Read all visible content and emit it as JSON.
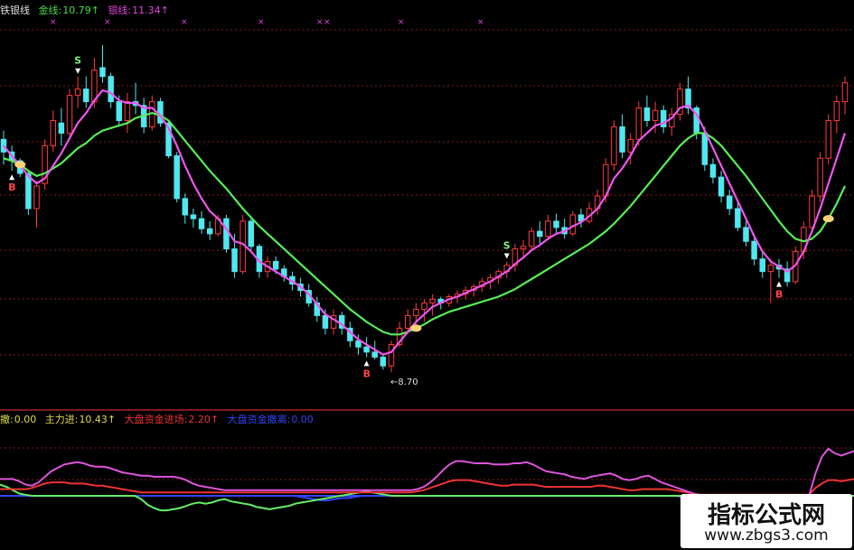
{
  "chart_data": {
    "type": "candlestick",
    "main_panel": {
      "legend": [
        {
          "label": "铁银线",
          "value": "",
          "color": "#e0e0e0"
        },
        {
          "label": "金线:",
          "value": "10.79↑",
          "color": "#44dd44"
        },
        {
          "label": "银线:",
          "value": "11.34↑",
          "color": "#dd44dd"
        }
      ],
      "annotations": {
        "low_price_label": "←8.70",
        "sell_marker": "S",
        "buy_marker": "B"
      },
      "candles": [
        [
          10.55,
          10.62,
          10.35,
          10.45
        ],
        [
          10.45,
          10.5,
          10.3,
          10.38
        ],
        [
          10.38,
          10.4,
          10.25,
          10.28
        ],
        [
          10.28,
          10.3,
          9.95,
          10.0
        ],
        [
          10.0,
          10.22,
          9.85,
          10.18
        ],
        [
          10.2,
          10.55,
          10.15,
          10.5
        ],
        [
          10.5,
          10.78,
          10.45,
          10.7
        ],
        [
          10.68,
          10.8,
          10.5,
          10.6
        ],
        [
          10.6,
          10.95,
          10.58,
          10.9
        ],
        [
          10.9,
          11.05,
          10.8,
          10.95
        ],
        [
          10.95,
          11.05,
          10.8,
          10.85
        ],
        [
          10.85,
          11.2,
          10.8,
          11.1
        ],
        [
          11.12,
          11.3,
          11.0,
          11.05
        ],
        [
          11.05,
          11.08,
          10.8,
          10.85
        ],
        [
          10.85,
          10.9,
          10.65,
          10.7
        ],
        [
          10.7,
          10.92,
          10.6,
          10.85
        ],
        [
          10.85,
          11.0,
          10.75,
          10.82
        ],
        [
          10.82,
          10.88,
          10.6,
          10.65
        ],
        [
          10.65,
          10.9,
          10.62,
          10.85
        ],
        [
          10.85,
          10.88,
          10.65,
          10.68
        ],
        [
          10.68,
          10.7,
          10.4,
          10.42
        ],
        [
          10.42,
          10.45,
          10.05,
          10.08
        ],
        [
          10.08,
          10.12,
          9.88,
          9.95
        ],
        [
          9.95,
          10.0,
          9.85,
          9.92
        ],
        [
          9.92,
          9.98,
          9.8,
          9.84
        ],
        [
          9.84,
          9.9,
          9.75,
          9.8
        ],
        [
          9.8,
          9.95,
          9.78,
          9.92
        ],
        [
          9.92,
          9.95,
          9.65,
          9.68
        ],
        [
          9.68,
          9.8,
          9.45,
          9.5
        ],
        [
          9.5,
          9.95,
          9.48,
          9.9
        ],
        [
          9.9,
          9.92,
          9.65,
          9.7
        ],
        [
          9.7,
          9.72,
          9.45,
          9.5
        ],
        [
          9.5,
          9.62,
          9.45,
          9.58
        ],
        [
          9.58,
          9.62,
          9.48,
          9.52
        ],
        [
          9.52,
          9.55,
          9.42,
          9.46
        ],
        [
          9.46,
          9.5,
          9.35,
          9.4
        ],
        [
          9.4,
          9.45,
          9.3,
          9.35
        ],
        [
          9.35,
          9.4,
          9.22,
          9.25
        ],
        [
          9.25,
          9.3,
          9.1,
          9.15
        ],
        [
          9.15,
          9.2,
          9.0,
          9.05
        ],
        [
          9.05,
          9.2,
          9.0,
          9.15
        ],
        [
          9.15,
          9.18,
          9.0,
          9.05
        ],
        [
          9.05,
          9.1,
          8.9,
          8.95
        ],
        [
          8.95,
          9.0,
          8.84,
          8.9
        ],
        [
          8.9,
          8.98,
          8.82,
          8.86
        ],
        [
          8.86,
          8.95,
          8.8,
          8.82
        ],
        [
          8.82,
          8.85,
          8.72,
          8.75
        ],
        [
          8.75,
          8.95,
          8.7,
          8.92
        ],
        [
          8.92,
          9.1,
          8.9,
          9.05
        ],
        [
          9.05,
          9.2,
          9.0,
          9.15
        ],
        [
          9.15,
          9.25,
          9.05,
          9.2
        ],
        [
          9.2,
          9.28,
          9.1,
          9.25
        ],
        [
          9.25,
          9.32,
          9.15,
          9.28
        ],
        [
          9.28,
          9.3,
          9.2,
          9.25
        ],
        [
          9.25,
          9.32,
          9.22,
          9.3
        ],
        [
          9.3,
          9.35,
          9.25,
          9.32
        ],
        [
          9.32,
          9.38,
          9.28,
          9.35
        ],
        [
          9.35,
          9.4,
          9.3,
          9.38
        ],
        [
          9.38,
          9.45,
          9.34,
          9.42
        ],
        [
          9.42,
          9.48,
          9.36,
          9.45
        ],
        [
          9.45,
          9.52,
          9.4,
          9.5
        ],
        [
          9.5,
          9.58,
          9.45,
          9.55
        ],
        [
          9.55,
          9.72,
          9.5,
          9.68
        ],
        [
          9.68,
          9.75,
          9.6,
          9.7
        ],
        [
          9.7,
          9.85,
          9.66,
          9.82
        ],
        [
          9.82,
          9.9,
          9.72,
          9.78
        ],
        [
          9.78,
          9.95,
          9.75,
          9.9
        ],
        [
          9.9,
          9.96,
          9.8,
          9.85
        ],
        [
          9.85,
          9.92,
          9.76,
          9.8
        ],
        [
          9.8,
          9.98,
          9.78,
          9.95
        ],
        [
          9.95,
          10.0,
          9.85,
          9.9
        ],
        [
          9.9,
          10.05,
          9.88,
          10.0
        ],
        [
          10.0,
          10.15,
          9.95,
          10.1
        ],
        [
          10.1,
          10.4,
          10.05,
          10.35
        ],
        [
          10.35,
          10.7,
          10.3,
          10.65
        ],
        [
          10.65,
          10.75,
          10.4,
          10.45
        ],
        [
          10.45,
          10.6,
          10.35,
          10.55
        ],
        [
          10.55,
          10.85,
          10.5,
          10.8
        ],
        [
          10.8,
          10.9,
          10.65,
          10.7
        ],
        [
          10.7,
          10.85,
          10.6,
          10.78
        ],
        [
          10.78,
          10.82,
          10.6,
          10.65
        ],
        [
          10.65,
          10.8,
          10.58,
          10.75
        ],
        [
          10.75,
          11.0,
          10.7,
          10.95
        ],
        [
          10.95,
          11.05,
          10.75,
          10.8
        ],
        [
          10.8,
          10.82,
          10.55,
          10.6
        ],
        [
          10.6,
          10.65,
          10.3,
          10.35
        ],
        [
          10.35,
          10.4,
          10.2,
          10.25
        ],
        [
          10.25,
          10.3,
          10.05,
          10.1
        ],
        [
          10.1,
          10.15,
          9.95,
          10.0
        ],
        [
          10.0,
          10.05,
          9.82,
          9.85
        ],
        [
          9.85,
          9.9,
          9.7,
          9.74
        ],
        [
          9.74,
          9.8,
          9.55,
          9.6
        ],
        [
          9.6,
          9.65,
          9.45,
          9.5
        ],
        [
          9.5,
          9.6,
          9.25,
          9.55
        ],
        [
          9.55,
          9.6,
          9.45,
          9.52
        ],
        [
          9.52,
          9.58,
          9.38,
          9.42
        ],
        [
          9.42,
          9.7,
          9.4,
          9.66
        ],
        [
          9.66,
          9.9,
          9.6,
          9.85
        ],
        [
          9.85,
          10.15,
          9.8,
          10.1
        ],
        [
          10.1,
          10.45,
          10.05,
          10.4
        ],
        [
          10.4,
          10.75,
          10.35,
          10.7
        ],
        [
          10.7,
          10.9,
          10.6,
          10.85
        ],
        [
          10.85,
          11.05,
          10.75,
          11.0
        ]
      ],
      "gold_line": [
        10.4,
        10.38,
        10.35,
        10.3,
        10.26,
        10.28,
        10.32,
        10.36,
        10.42,
        10.48,
        10.52,
        10.58,
        10.62,
        10.64,
        10.66,
        10.68,
        10.72,
        10.74,
        10.76,
        10.74,
        10.7,
        10.62,
        10.54,
        10.46,
        10.38,
        10.3,
        10.23,
        10.16,
        10.08,
        10.0,
        9.93,
        9.86,
        9.8,
        9.74,
        9.68,
        9.62,
        9.56,
        9.5,
        9.44,
        9.38,
        9.32,
        9.26,
        9.2,
        9.15,
        9.1,
        9.06,
        9.02,
        9.0,
        9.0,
        9.02,
        9.05,
        9.08,
        9.12,
        9.15,
        9.18,
        9.2,
        9.22,
        9.24,
        9.26,
        9.28,
        9.3,
        9.33,
        9.36,
        9.4,
        9.44,
        9.48,
        9.52,
        9.56,
        9.6,
        9.64,
        9.68,
        9.72,
        9.77,
        9.82,
        9.88,
        9.95,
        10.02,
        10.1,
        10.18,
        10.26,
        10.34,
        10.42,
        10.5,
        10.56,
        10.6,
        10.6,
        10.56,
        10.5,
        10.42,
        10.34,
        10.26,
        10.17,
        10.08,
        9.99,
        9.9,
        9.82,
        9.76,
        9.74,
        9.76,
        9.82,
        9.92,
        10.04,
        10.18
      ],
      "silver_line": [
        10.5,
        10.42,
        10.34,
        10.26,
        10.2,
        10.24,
        10.34,
        10.44,
        10.56,
        10.68,
        10.76,
        10.86,
        10.94,
        10.92,
        10.86,
        10.84,
        10.84,
        10.8,
        10.8,
        10.74,
        10.64,
        10.5,
        10.34,
        10.2,
        10.08,
        9.98,
        9.92,
        9.84,
        9.74,
        9.72,
        9.66,
        9.58,
        9.54,
        9.5,
        9.46,
        9.42,
        9.38,
        9.32,
        9.24,
        9.16,
        9.12,
        9.08,
        9.02,
        8.96,
        8.92,
        8.88,
        8.84,
        8.86,
        8.94,
        9.02,
        9.1,
        9.16,
        9.22,
        9.25,
        9.28,
        9.3,
        9.33,
        9.36,
        9.39,
        9.42,
        9.46,
        9.5,
        9.56,
        9.61,
        9.67,
        9.71,
        9.76,
        9.8,
        9.82,
        9.86,
        9.89,
        9.94,
        10.0,
        10.1,
        10.24,
        10.32,
        10.42,
        10.54,
        10.6,
        10.66,
        10.68,
        10.72,
        10.8,
        10.82,
        10.75,
        10.62,
        10.48,
        10.34,
        10.2,
        10.06,
        9.92,
        9.78,
        9.66,
        9.58,
        9.54,
        9.5,
        9.55,
        9.66,
        9.82,
        10.0,
        10.2,
        10.4,
        10.6
      ],
      "sell_signals": [
        [
          9,
          "S"
        ],
        [
          61,
          "S"
        ]
      ],
      "buy_signals": [
        [
          1,
          "B"
        ],
        [
          44,
          "B"
        ],
        [
          94,
          "B"
        ]
      ],
      "highlights": [
        2,
        50,
        100
      ]
    },
    "sub_panel": {
      "legend": [
        {
          "label": "撤:",
          "value": "0.00",
          "color": "#dddd44"
        },
        {
          "label": "主力进:",
          "value": "10.43↑",
          "color": "#dddd44"
        },
        {
          "label": "大盘资金进场:",
          "value": "2.20↑",
          "color": "#ee3333"
        },
        {
          "label": "大盘资金撤离:",
          "value": "0.00",
          "color": "#3344ee"
        }
      ],
      "magenta": [
        30,
        30,
        30,
        26,
        20,
        18,
        24,
        34,
        44,
        50,
        56,
        58,
        60,
        58,
        54,
        52,
        52,
        50,
        46,
        42,
        40,
        38,
        36,
        36,
        34,
        34,
        34,
        34,
        32,
        28,
        22,
        18,
        16,
        14,
        12,
        10,
        10,
        10,
        10,
        10,
        10,
        10,
        10,
        10,
        10,
        10,
        10,
        10,
        10,
        10,
        10,
        10,
        10,
        10,
        10,
        10,
        10,
        10,
        10,
        10,
        10,
        10,
        10,
        10,
        10,
        12,
        16,
        24,
        34,
        46,
        56,
        62,
        62,
        60,
        58,
        58,
        58,
        56,
        56,
        56,
        58,
        58,
        60,
        56,
        50,
        44,
        42,
        40,
        38,
        34,
        32,
        30,
        34,
        36,
        38,
        40,
        36,
        30,
        28,
        30,
        34,
        36,
        30,
        24,
        20,
        16,
        12,
        8,
        4,
        0,
        0,
        0,
        0,
        0,
        0,
        0,
        0,
        0,
        0,
        0,
        0,
        0,
        0,
        0,
        0,
        0,
        0,
        40,
        70,
        84,
        76,
        72,
        76,
        80
      ],
      "red": [
        12,
        12,
        12,
        12,
        12,
        14,
        18,
        22,
        24,
        24,
        24,
        22,
        22,
        22,
        20,
        18,
        18,
        16,
        14,
        12,
        10,
        8,
        6,
        6,
        6,
        6,
        6,
        6,
        6,
        6,
        6,
        6,
        6,
        6,
        6,
        6,
        6,
        6,
        6,
        6,
        6,
        6,
        6,
        6,
        6,
        6,
        6,
        6,
        6,
        6,
        6,
        6,
        6,
        6,
        6,
        6,
        6,
        6,
        6,
        6,
        6,
        6,
        6,
        6,
        6,
        8,
        10,
        14,
        18,
        22,
        26,
        28,
        28,
        28,
        26,
        24,
        22,
        20,
        18,
        18,
        20,
        20,
        20,
        20,
        18,
        16,
        16,
        16,
        16,
        16,
        16,
        16,
        16,
        18,
        18,
        16,
        14,
        12,
        10,
        10,
        12,
        12,
        12,
        12,
        12,
        10,
        8,
        6,
        4,
        2,
        2,
        2,
        2,
        2,
        2,
        2,
        2,
        2,
        2,
        2,
        2,
        2,
        2,
        2,
        2,
        2,
        2,
        14,
        22,
        28,
        28,
        26,
        28,
        30
      ],
      "green": [
        20,
        16,
        10,
        4,
        2,
        0,
        0,
        0,
        0,
        0,
        0,
        0,
        0,
        0,
        0,
        0,
        0,
        0,
        0,
        0,
        0,
        0,
        -6,
        -16,
        -22,
        -26,
        -26,
        -24,
        -22,
        -18,
        -14,
        -12,
        -14,
        -12,
        -8,
        -6,
        -10,
        -12,
        -14,
        -16,
        -20,
        -22,
        -24,
        -22,
        -20,
        -18,
        -14,
        -12,
        -10,
        -8,
        -6,
        -4,
        -2,
        0,
        2,
        4,
        6,
        8,
        6,
        4,
        2,
        0,
        0,
        0,
        0,
        0,
        0,
        0,
        0,
        0,
        0,
        0,
        0,
        0,
        0,
        0,
        0,
        0,
        0,
        0,
        0,
        0,
        0,
        0,
        0,
        0,
        0,
        0,
        0,
        0,
        0,
        0,
        0,
        0,
        0,
        0,
        0,
        0,
        0,
        0,
        0,
        0,
        0,
        0,
        0,
        0,
        0,
        0,
        0,
        0,
        0,
        0,
        0,
        0,
        0,
        0,
        0,
        0,
        0,
        0,
        0,
        0,
        0,
        0,
        0,
        0,
        0,
        0,
        0,
        0,
        0,
        0,
        0,
        0
      ],
      "blue": [
        0,
        0,
        0,
        0,
        0,
        0,
        0,
        0,
        0,
        0,
        0,
        0,
        0,
        0,
        0,
        0,
        0,
        0,
        0,
        0,
        0,
        0,
        0,
        0,
        0,
        0,
        0,
        0,
        0,
        0,
        0,
        0,
        0,
        0,
        0,
        0,
        0,
        0,
        0,
        0,
        0,
        0,
        0,
        0,
        -2,
        -4,
        -6,
        -8,
        -8,
        -6,
        -4,
        -4,
        -2,
        0,
        0,
        0,
        0,
        0,
        0,
        0,
        0,
        0,
        0,
        0,
        0,
        0,
        0,
        0,
        0,
        0,
        0,
        0,
        0,
        0,
        0,
        0,
        0,
        0,
        0,
        0,
        0,
        0,
        0,
        0,
        0,
        0,
        0,
        0,
        0,
        0,
        0,
        0,
        0,
        0,
        0,
        0,
        0,
        0,
        0,
        0,
        -4,
        -6,
        -8,
        -10,
        -10,
        -8,
        -6,
        -4,
        -2,
        0,
        0,
        0,
        0,
        0,
        0,
        0,
        0,
        0,
        0,
        0,
        0,
        0,
        0,
        0,
        0,
        0
      ]
    }
  },
  "watermark": {
    "title": "指标公式网",
    "url": "www.zbgs3.com"
  },
  "colors": {
    "up": "#ff3b3b",
    "down": "#4fe8f0",
    "gold_line": "#55ee55",
    "silver_line": "#ee55ee",
    "grid": "#8a1a1a",
    "separator": "#b02020",
    "sell_marker": "#ffffff",
    "buy_marker": "#ff4444",
    "highlight": "#ffd27a"
  }
}
